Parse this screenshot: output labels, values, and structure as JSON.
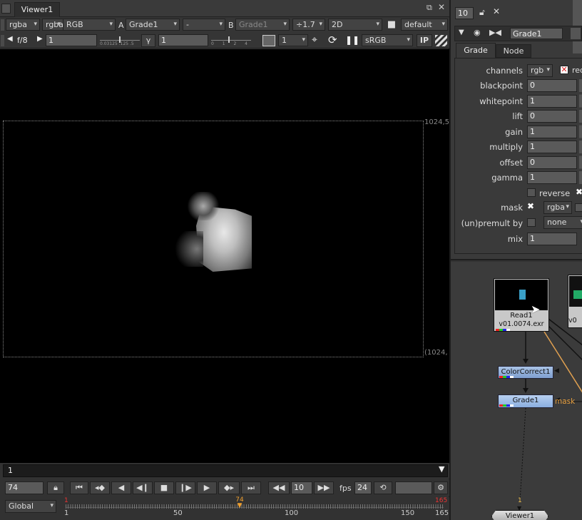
{
  "viewer": {
    "tab_label": "Viewer1",
    "toolbar1": {
      "channel1": "rgba",
      "channel2": "rgba",
      "colorspace": "RGB",
      "a_label": "A",
      "a_input": "Grade1",
      "composite": "-",
      "b_label": "B",
      "b_input": "Grade1",
      "downscale": "÷1.7",
      "view_mode": "2D",
      "lut": "default"
    },
    "toolbar2": {
      "fstop": "f/8",
      "gain_value": "1",
      "gain_scale": "0.03125 .125 .5",
      "gamma_label": "γ",
      "gamma_value": "1",
      "gamma_scale": "0 1 2 4",
      "proxy": "1",
      "display_lut": "sRGB",
      "ip_label": "IP"
    },
    "format_top": "1024,5",
    "format_bottom": "(1024,",
    "frame_input": "1"
  },
  "timeline": {
    "current_frame": "74",
    "increment": "10",
    "fps_label": "fps",
    "fps_value": "24",
    "scope": "Global",
    "ticks": [
      "1",
      "50",
      "100",
      "150",
      "165"
    ],
    "in_marker": "1",
    "out_marker": "165",
    "playhead": "74",
    "start": 1,
    "end": 165,
    "frame": 74
  },
  "properties": {
    "max_panels": "10",
    "node_name": "Grade1",
    "tabs": [
      "Grade",
      "Node"
    ],
    "channels_label": "channels",
    "channels_value": "rgb",
    "channels_red": "red",
    "rows": [
      {
        "label": "blackpoint",
        "value": "0"
      },
      {
        "label": "whitepoint",
        "value": "1"
      },
      {
        "label": "lift",
        "value": "0"
      },
      {
        "label": "gain",
        "value": "1"
      },
      {
        "label": "multiply",
        "value": "1"
      },
      {
        "label": "offset",
        "value": "0"
      },
      {
        "label": "gamma",
        "value": "1"
      }
    ],
    "reverse_label": "reverse",
    "mask_label": "mask",
    "mask_value": "rgba",
    "unpremult_label": "(un)premult by",
    "unpremult_value": "none",
    "mix_label": "mix",
    "mix_value": "1"
  },
  "nodegraph": {
    "read_node": "Read1",
    "read_file": "v01.0074.exr",
    "read2_file": "v0",
    "colorcorrect_node": "ColorCorrect1",
    "grade_node": "Grade1",
    "mask_label": "mask",
    "viewer_node": "Viewer1",
    "viewer_input": "1"
  }
}
